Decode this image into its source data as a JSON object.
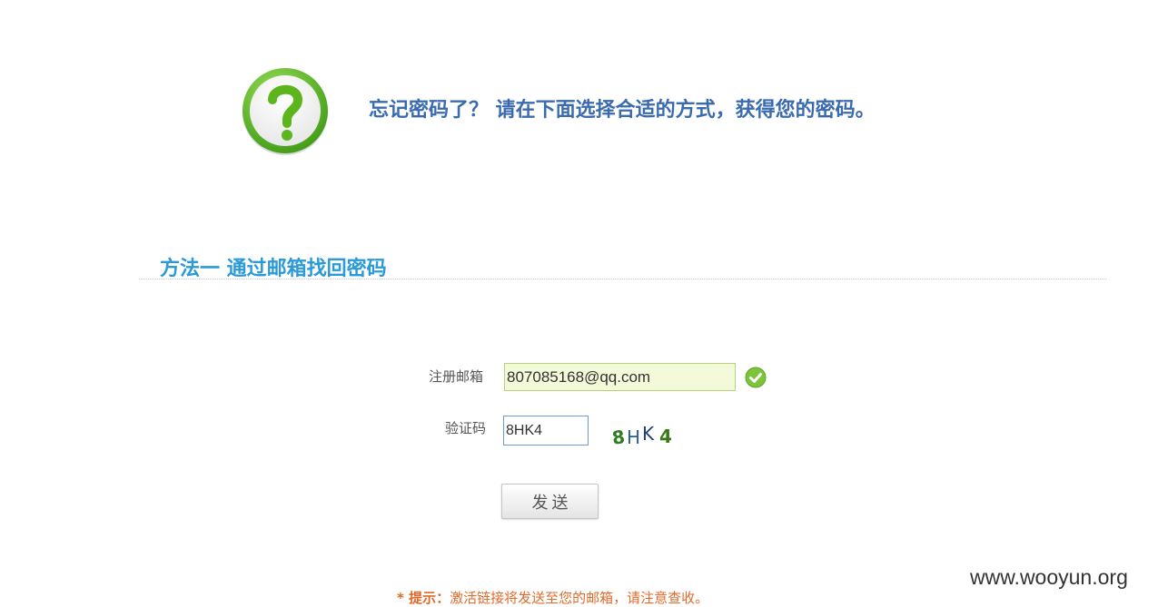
{
  "header": {
    "icon": "question-mark-icon",
    "title": "忘记密码了？ 请在下面选择合适的方式，获得您的密码。"
  },
  "method_one": {
    "title": "方法一 通过邮箱找回密码"
  },
  "form": {
    "email_label": "注册邮箱",
    "email_value": "807085168@qq.com",
    "email_status_icon": "check-circle-icon",
    "captcha_label": "验证码",
    "captcha_value": "8HK4",
    "captcha_image_chars": [
      "8",
      "H",
      "K",
      "4"
    ],
    "send_button_label": "发送"
  },
  "hint": {
    "prefix": "* 提示：",
    "text": "激活链接将发送至您的邮箱，请注意查收。"
  },
  "watermark": "www.wooyun.org",
  "colors": {
    "headline": "#3a6bb0",
    "section_title": "#2a9ad8",
    "hint": "#e06a2a",
    "icon_green": "#6bbf2a"
  }
}
